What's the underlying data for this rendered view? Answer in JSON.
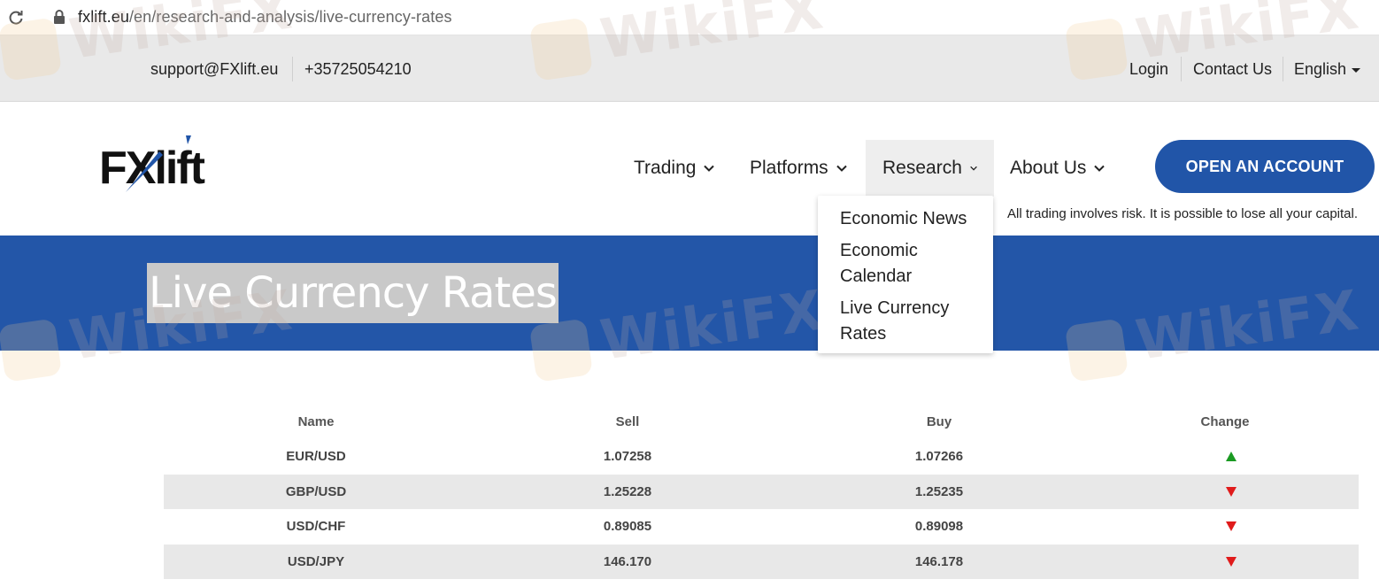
{
  "browser": {
    "url_host": "fxlift.eu",
    "url_path": "/en/research-and-analysis/live-currency-rates",
    "icons": {
      "reload": "reload-icon",
      "lock": "lock-icon"
    }
  },
  "topbar": {
    "email": "support@FXlift.eu",
    "phone": "+35725054210",
    "login": "Login",
    "contact_us": "Contact Us",
    "language": "English"
  },
  "header": {
    "logo_text": "FXlift",
    "nav": [
      {
        "label": "Trading"
      },
      {
        "label": "Platforms"
      },
      {
        "label": "Research"
      },
      {
        "label": "About Us"
      }
    ],
    "cta": "OPEN AN ACCOUNT",
    "risk_warning": "All trading involves risk. It is possible to lose all your capital."
  },
  "dropdown": {
    "items": [
      {
        "label": "Economic News"
      },
      {
        "label": "Economic Calendar"
      },
      {
        "label": "Live Currency Rates"
      }
    ]
  },
  "banner": {
    "title": "Live Currency Rates"
  },
  "rates": {
    "headers": {
      "name": "Name",
      "sell": "Sell",
      "buy": "Buy",
      "change": "Change"
    },
    "rows": [
      {
        "name": "EUR/USD",
        "sell": "1.07258",
        "buy": "1.07266",
        "change": "up"
      },
      {
        "name": "GBP/USD",
        "sell": "1.25228",
        "buy": "1.25235",
        "change": "down"
      },
      {
        "name": "USD/CHF",
        "sell": "0.89085",
        "buy": "0.89098",
        "change": "down"
      },
      {
        "name": "USD/JPY",
        "sell": "146.170",
        "buy": "146.178",
        "change": "down"
      }
    ],
    "colors": {
      "up": "#1a9a22",
      "down": "#e01b1b"
    }
  },
  "watermark": "WikiFX",
  "colors": {
    "brand_blue": "#2155a8",
    "banner_blue": "#2356a8"
  }
}
